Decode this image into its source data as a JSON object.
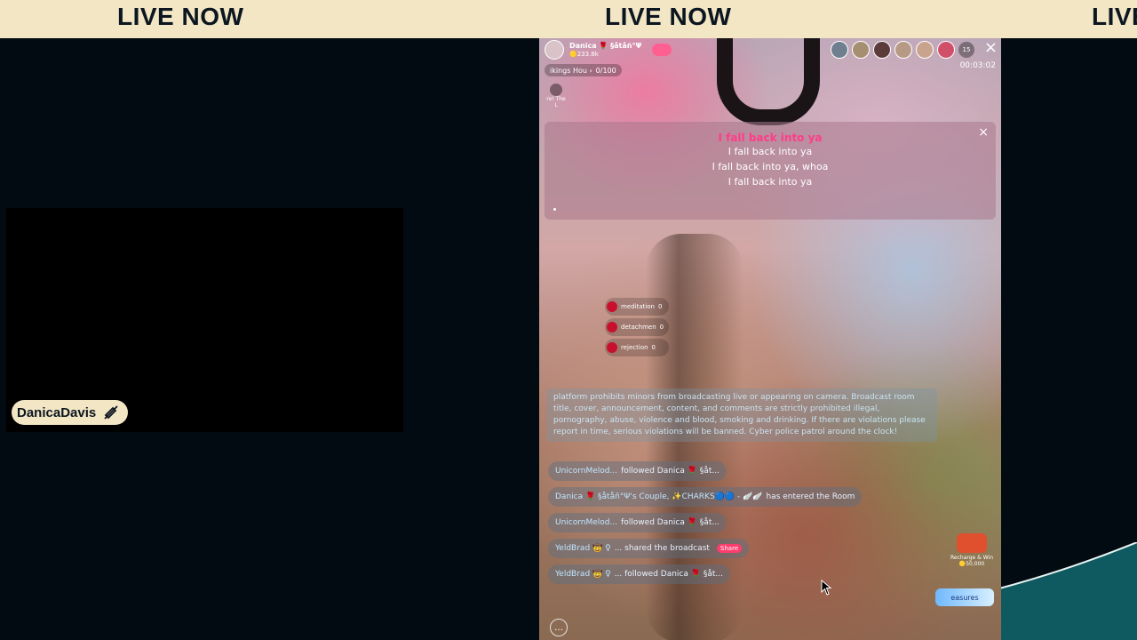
{
  "ticker": {
    "items": [
      "LIVE NOW",
      "LIVE NOW",
      "LIVE"
    ]
  },
  "overlay": {
    "streamer_name": "DanicaDavis"
  },
  "stream": {
    "host_name": "Danica 🌹 §åtåñ°Ψ",
    "host_coins": "🟡233.8k",
    "rank_text": "ikings Hou ›",
    "rank_sub": "0/100",
    "side_badge_label": "re! The L",
    "viewer_count": "15",
    "close": "×",
    "timer": "00:03:02",
    "lyrics": {
      "title": "I fall back into ya",
      "lines": [
        "I fall back into ya",
        "I fall back into ya, whoa",
        "I fall back into ya"
      ],
      "close": "×"
    },
    "gifts": [
      {
        "label": "meditation",
        "count": "0"
      },
      {
        "label": "detachmen",
        "count": "0"
      },
      {
        "label": "rejection",
        "count": "0"
      }
    ],
    "notice": "platform prohibits minors from broadcasting live or appearing on camera. Broadcast room title, cover, announcement, content, and comments are strictly prohibited illegal, pornography, abuse, violence and blood, smoking and drinking. If there are violations please report in time, serious violations will be banned. Cyber police patrol around the clock!",
    "chat": [
      {
        "user": "UnicornMelod...",
        "text": "followed Danica 🌹 §åt..."
      },
      {
        "user": "Danica 🌹 §åtåñ°Ψ's Couple, ✨CHARKS🔵🔵 - 🪽🪽",
        "text": "has entered the Room"
      },
      {
        "user": "UnicornMelod...",
        "text": "followed Danica 🌹 §åt..."
      },
      {
        "user": "YeldBrad 🤠 ♀",
        "text": "... shared the broadcast",
        "badge": "Share"
      },
      {
        "user": "YeldBrad 🤠 ♀",
        "text": "... followed Danica 🌹 §åt..."
      }
    ],
    "recharge_label": "Recharge & Win",
    "recharge_amount": "🟡50,000",
    "treasure_label": "easures"
  }
}
